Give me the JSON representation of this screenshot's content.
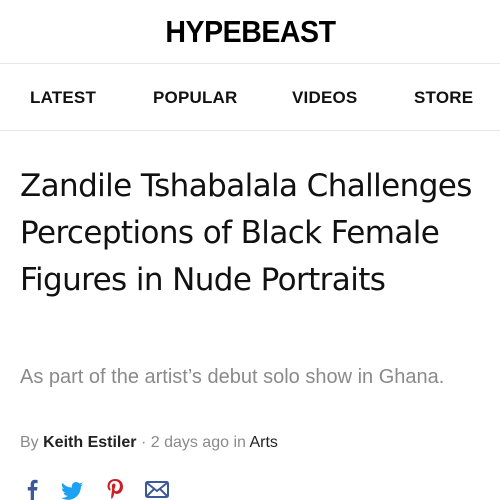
{
  "header": {
    "logo": "HYPEBEAST"
  },
  "nav": {
    "items": [
      {
        "label": "LATEST"
      },
      {
        "label": "POPULAR"
      },
      {
        "label": "VIDEOS"
      },
      {
        "label": "STORE"
      }
    ]
  },
  "article": {
    "title": "Zandile Tshabalala Challenges Perceptions of Black Female Figures in Nude Portraits",
    "subtitle": "As part of the artist’s debut solo show in Ghana.",
    "byline": {
      "prefix": "By",
      "author": "Keith Estiler",
      "separator": "·",
      "time": "2 days ago",
      "in": "in",
      "category": "Arts"
    }
  },
  "share": {
    "icons": [
      "facebook-icon",
      "twitter-icon",
      "pinterest-icon",
      "email-icon"
    ],
    "colors": {
      "facebook": "#3b5998",
      "twitter": "#1da1f2",
      "pinterest": "#cb2027",
      "email": "#3b5998"
    }
  }
}
